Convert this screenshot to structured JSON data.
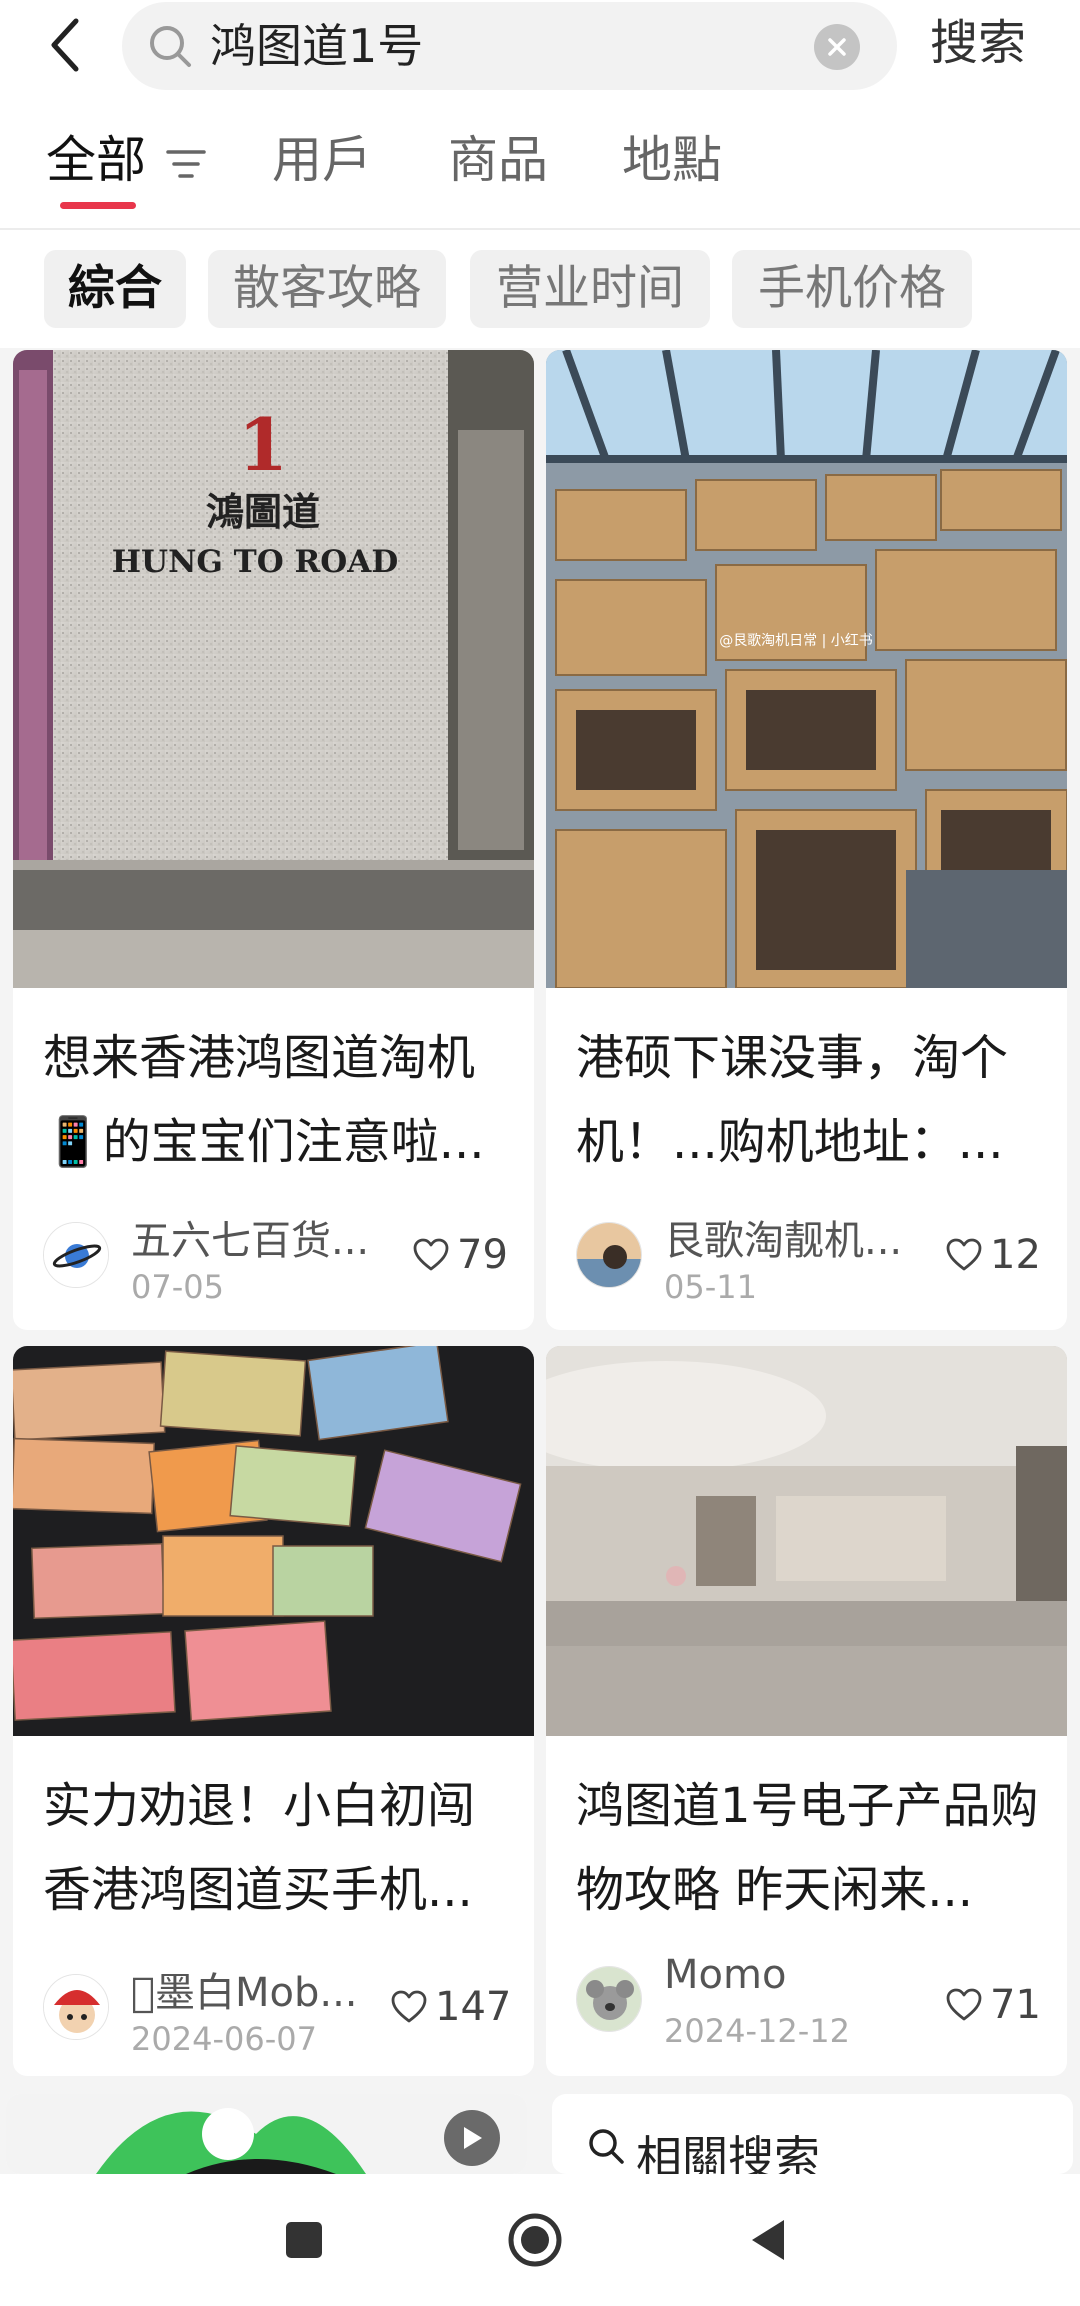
{
  "search": {
    "query": "鸿图道1号",
    "submit_label": "搜索",
    "back_icon": "back-arrow-icon",
    "search_icon": "search-icon",
    "clear_icon": "clear-icon"
  },
  "tabs": [
    {
      "label": "全部",
      "active": true
    },
    {
      "label": "用戶",
      "active": false
    },
    {
      "label": "商品",
      "active": false
    },
    {
      "label": "地點",
      "active": false
    }
  ],
  "chips": [
    {
      "label": "綜合",
      "active": true
    },
    {
      "label": "散客攻略",
      "active": false
    },
    {
      "label": "营业时间",
      "active": false
    },
    {
      "label": "手机价格",
      "active": false
    }
  ],
  "feed": [
    {
      "title": "想来香港鸿图道淘机📱的宝宝们注意啦...",
      "author": "五六七百货...",
      "date": "07-05",
      "likes": "79",
      "image": {
        "number": "1",
        "chinese": "鴻圖道",
        "english": "HUNG TO ROAD"
      }
    },
    {
      "title": "港硕下课没事，淘个机！...购机地址：...",
      "author": "艮歌淘靓机...",
      "date": "05-11",
      "likes": "12",
      "image": {
        "watermark": "@艮歌淘机日常 | 小红书"
      }
    },
    {
      "title": "实力劝退！小白初闯香港鸿图道买手机...",
      "author": "󰀀墨白Mob...",
      "date": "2024-06-07",
      "likes": "147"
    },
    {
      "title": "鸿图道1号电子产品购物攻略 昨天闲来...",
      "author": "Momo",
      "date": "2024-12-12",
      "likes": "71"
    }
  ],
  "related": {
    "title": "相關搜索"
  },
  "colors": {
    "accent": "#e8364b",
    "chip_bg": "#f0f0f0",
    "page_bg": "#f4f4f4"
  },
  "system_nav": {
    "recent_icon": "square-recents-icon",
    "home_icon": "circle-home-icon",
    "back_icon": "triangle-back-icon"
  }
}
